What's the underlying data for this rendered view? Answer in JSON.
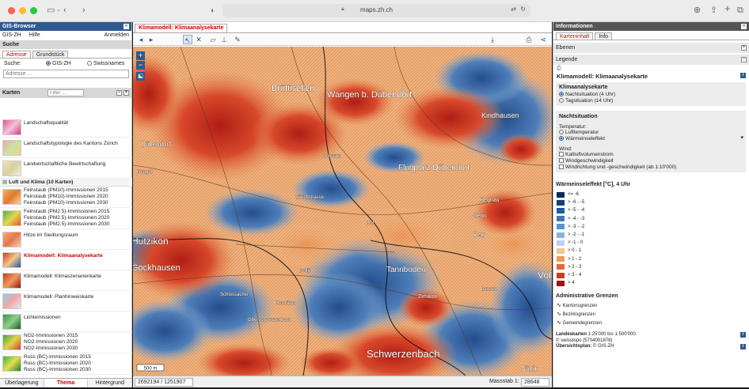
{
  "browser": {
    "url": "maps.zh.ch"
  },
  "left": {
    "header": "GIS-Browser",
    "menu": [
      "GIS-ZH",
      "Hilfe"
    ],
    "login": "Anmelden",
    "search_header": "Suche",
    "search_tabs": [
      "Adresse",
      "Grundstück"
    ],
    "search_label": "Suche:",
    "search_options": [
      "GIS-ZH",
      "Swissnames"
    ],
    "search_placeholder": "Adresse ...",
    "maps_header": "Karten",
    "filter_placeholder": "Filter ...",
    "group_title": "Luft und Klima (10 Karten)",
    "layers_top": [
      {
        "label": "Landschaftsqualität"
      },
      {
        "label": "Landschaftstypologie des Kantons Zürich"
      },
      {
        "label": "Landwirtschaftliche Bewirtschaftung"
      }
    ],
    "layers": [
      {
        "lines": [
          "Feinstaub (PM10)-Immissionen 2015",
          "Feinstaub (PM10)-Immissionen 2020",
          "Feinstaub (PM10)-Immissionen 2030"
        ]
      },
      {
        "lines": [
          "Feinstaub (PM2.5)-Immissionen 2015",
          "Feinstaub (PM2.5)-Immissionen 2020",
          "Feinstaub (PM2.5)-Immissionen 2030"
        ]
      },
      {
        "lines": [
          "Hitze im Siedlungsraum"
        ]
      },
      {
        "lines": [
          "Klimamodell: Klimaanalysekarte"
        ],
        "active": true
      },
      {
        "lines": [
          "Klimamodell: Klimaszenarienkarte"
        ]
      },
      {
        "lines": [
          "Klimamodell: Planhinweiskarte"
        ]
      },
      {
        "lines": [
          "Lichtemissionen"
        ]
      },
      {
        "lines": [
          "NO2-Immissionen 2015",
          "NO2-Immissionen 2020",
          "NO2-Immissionen 2030"
        ]
      },
      {
        "lines": [
          "Russ (BC)-Immissionen 2015",
          "Russ (BC)-Immissionen 2020",
          "Russ (BC)-Immissionen 2030"
        ]
      }
    ],
    "bottom_tabs": [
      "Überlagerung",
      "Thema",
      "Hintergrund"
    ]
  },
  "center": {
    "map_tab": "Klimamodell: Klimaanalysekarte",
    "coords": "2692194 / 1251907",
    "scale_label": "Massstab 1:",
    "scale_value": "28648",
    "scalebar": "500 m",
    "places": [
      "Brüttisellen",
      "Wangen b. Dübendorf",
      "Kindhausen",
      "Dübendorf",
      "Neugut",
      "Zürichstrasse",
      "Flugplatz Dübendorf",
      "Hegnau",
      "Gfenn",
      "Berg",
      "Hutzikon",
      "Gockhausen",
      "Schwerzenbach",
      "Hermikon",
      "Zimikon",
      "Tannboden",
      "Schlossacher",
      "Oberschwerzenbach",
      "Volk",
      "Nänik",
      "Hof",
      "Schwarz",
      "Lanzen",
      "Bettli"
    ]
  },
  "right": {
    "header": "Informationen",
    "tabs": [
      "Karteninhalt",
      "Info"
    ],
    "sections": [
      "Ebenen",
      "Legende"
    ],
    "map_title": "Klimamodell: Klimaanalysekarte",
    "box1_title": "Klimaanalysekarte",
    "box1_options": [
      "Nachtsituation (4 Uhr)",
      "Tagsituation (14 Uhr)"
    ],
    "box2_title": "Nachtsituation",
    "temp_label": "Temperatur:",
    "temp_options": [
      "Lufttemperatur",
      "Wärmeinseleffekt"
    ],
    "wind_label": "Wind:",
    "wind_options": [
      "Kaltluftvolumenstrom",
      "Windgeschwindigkeit",
      "Windrichtung und -geschwindigkeit (ab 1:10'000)"
    ],
    "legend_title": "Wärmeinseleffekt [°C], 4 Uhr",
    "legend": [
      {
        "label": "<= -6",
        "color": "#0b2a5c"
      },
      {
        "label": "> -6 - -5",
        "color": "#163f7e"
      },
      {
        "label": "> -5 - -4",
        "color": "#1f5c9f"
      },
      {
        "label": "> -4 - -3",
        "color": "#3b78b8"
      },
      {
        "label": "> -3 - -2",
        "color": "#5a95cc"
      },
      {
        "label": "> -2 - -1",
        "color": "#86b3dc"
      },
      {
        "label": "> -1 - 0",
        "color": "#b8d3ea"
      },
      {
        "label": "> 0 - 1",
        "color": "#f6c58d"
      },
      {
        "label": "> 1 - 2",
        "color": "#ef9a5c"
      },
      {
        "label": "> 2 - 3",
        "color": "#e36a3c"
      },
      {
        "label": "> 3 - 4",
        "color": "#cc3a22"
      },
      {
        "label": "> 4",
        "color": "#9c1414"
      }
    ],
    "admin_title": "Administrative Grenzen",
    "admin_items": [
      "Kantonsgrenzen",
      "Bezirksgrenzen",
      "Gemeindegrenzen"
    ],
    "credits": [
      {
        "label": "Landeskarten",
        "text": " 1:25'000 bis 1:500'000:"
      },
      {
        "label": "",
        "text": "© swisstopo (5704001878)"
      },
      {
        "label": "Übersichtsplan:",
        "text": " © GIS-ZH"
      }
    ]
  }
}
